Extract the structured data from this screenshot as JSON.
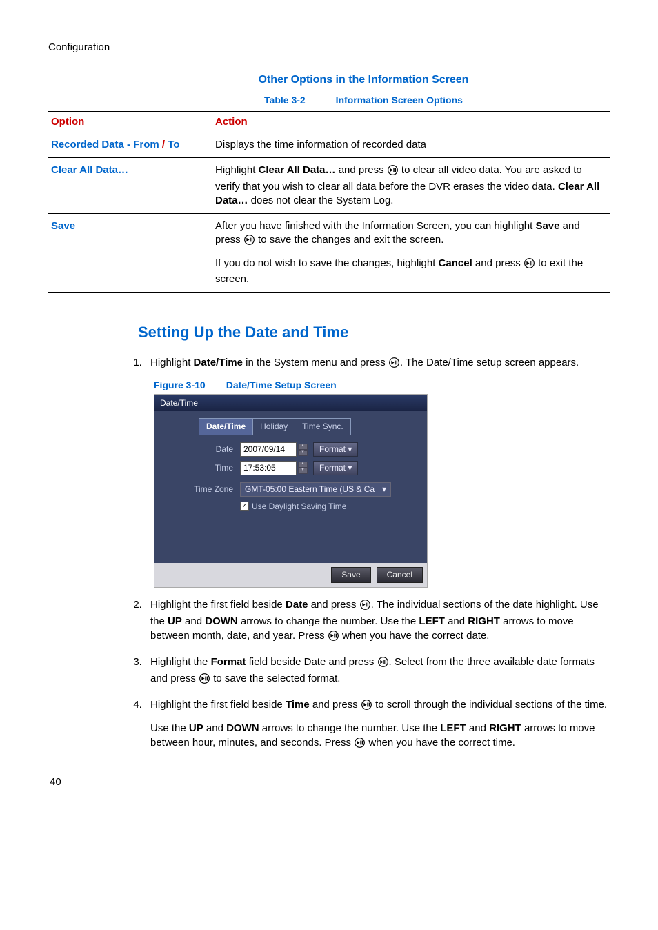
{
  "header": {
    "section": "Configuration"
  },
  "subheading": "Other Options in the Information Screen",
  "table_caption": {
    "label": "Table 3-2",
    "title": "Information Screen Options"
  },
  "table": {
    "headers": {
      "option": "Option",
      "action": "Action"
    },
    "rows": [
      {
        "option": "Recorded Data - From / To",
        "action": "Displays the time information of recorded data"
      },
      {
        "option": "Clear All Data…",
        "action_parts": {
          "p1a": "Highlight ",
          "p1b": "Clear All Data…",
          "p1c": " and press ",
          "p1d": " to clear all video data. You are asked to verify that you wish to clear all data before the DVR erases the video data. ",
          "p1e": "Clear All Data…",
          "p1f": " does not clear the System Log."
        }
      },
      {
        "option": "Save",
        "action_parts": {
          "p1a": "After you have finished with the Information Screen, you can highlight ",
          "p1b": "Save",
          "p1c": " and press ",
          "p1d": " to save the changes and exit the screen.",
          "p2a": "If you do not wish to save the changes, highlight ",
          "p2b": "Cancel",
          "p2c": " and press ",
          "p2d": " to exit the screen."
        }
      }
    ]
  },
  "section_heading": "Setting Up the Date and Time",
  "steps": {
    "s1": {
      "a": "Highlight ",
      "b": "Date/Time",
      "c": " in the System menu and press ",
      "d": ". The Date/Time setup screen appears."
    },
    "fig": {
      "label": "Figure 3-10",
      "title": "Date/Time Setup Screen"
    },
    "screenshot": {
      "title": "Date/Time",
      "tabs": {
        "t1": "Date/Time",
        "t2": "Holiday",
        "t3": "Time Sync."
      },
      "date_label": "Date",
      "date_value": "2007/09/14",
      "format_btn": "Format",
      "time_label": "Time",
      "time_value": "17:53:05",
      "tz_label": "Time Zone",
      "tz_value": "GMT-05:00  Eastern Time (US & Ca",
      "dst": "Use Daylight Saving Time",
      "save": "Save",
      "cancel": "Cancel"
    },
    "s2": {
      "a": "Highlight the first field beside ",
      "b": "Date",
      "c": " and press ",
      "d": ". The individual sections of the date highlight. Use the ",
      "e": "UP",
      "f": " and ",
      "g": "DOWN",
      "h": " arrows to change the number. Use the ",
      "i": "LEFT",
      "j": " and ",
      "k": "RIGHT",
      "l": " arrows to move between month, date, and year. Press ",
      "m": " when you have the correct date."
    },
    "s3": {
      "a": "Highlight the ",
      "b": "Format",
      "c": " field beside Date and press ",
      "d": ". Select from the three available date formats and press ",
      "e": " to save the selected format."
    },
    "s4": {
      "a": "Highlight the first field beside ",
      "b": "Time",
      "c": " and press ",
      "d": " to scroll through the individual sections of the time.",
      "sub_a": "Use the ",
      "sub_b": "UP",
      "sub_c": " and ",
      "sub_d": "DOWN",
      "sub_e": " arrows to change the number. Use the ",
      "sub_f": "LEFT",
      "sub_g": " and ",
      "sub_h": "RIGHT",
      "sub_i": " arrows to move between hour, minutes, and seconds. Press ",
      "sub_j": " when you have the correct time."
    }
  },
  "page_number": "40"
}
